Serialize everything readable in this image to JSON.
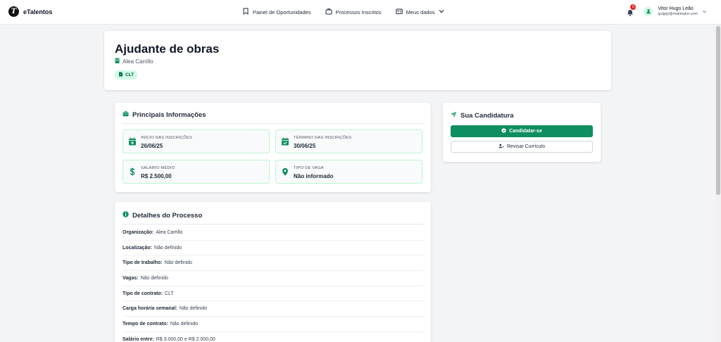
{
  "brand": {
    "name": "eTalentos",
    "logo_letter": "T"
  },
  "nav": {
    "items": [
      {
        "label": "Painel de Oportunidades",
        "icon": "bookmark-icon"
      },
      {
        "label": "Processos Inscritos",
        "icon": "briefcase-icon"
      },
      {
        "label": "Meus dados",
        "icon": "id-card-icon"
      }
    ]
  },
  "user": {
    "notifications": "0",
    "name": "Vitor Hugo Leão",
    "email": "guijpjy@mailinator.com"
  },
  "job": {
    "title": "Ajudante de obras",
    "company": "Alea Carrillo",
    "contract_badge": "CLT"
  },
  "info": {
    "title": "Principais Informações",
    "tiles": [
      {
        "label": "INÍCIO DAS INSCRIÇÕES",
        "value": "26/06/25",
        "icon": "calendar-plus-icon"
      },
      {
        "label": "TÉRMINO DAS INSCRIÇÕES",
        "value": "30/06/25",
        "icon": "calendar-check-icon"
      },
      {
        "label": "SALÁRIO MÉDIO",
        "value": "R$ 2.500,00",
        "icon": "dollar-icon"
      },
      {
        "label": "TIPO DE VAGA",
        "value": "Não informado",
        "icon": "map-pin-icon"
      }
    ]
  },
  "application": {
    "title": "Sua Candidatura",
    "apply_label": "Candidatar-se",
    "review_label": "Revisar Currículo"
  },
  "details": {
    "title": "Detalhes do Processo",
    "rows": [
      {
        "key": "Organização:",
        "value": "Alea Carrillo"
      },
      {
        "key": "Localização:",
        "value": "Não definido"
      },
      {
        "key": "Tipo de trabalho:",
        "value": "Não definido"
      },
      {
        "key": "Vagas:",
        "value": "Não definido"
      },
      {
        "key": "Tipo de contrato:",
        "value": "CLT"
      },
      {
        "key": "Carga horária semanal:",
        "value": "Não definido"
      },
      {
        "key": "Tempo de contrato:",
        "value": "Não definido"
      },
      {
        "key": "Salário entre:",
        "value": "R$ 3.000,00 e R$ 2.000,00"
      }
    ]
  },
  "colors": {
    "accent": "#0f8f5f",
    "accent_light": "#d1fae5",
    "danger": "#dc2626"
  }
}
